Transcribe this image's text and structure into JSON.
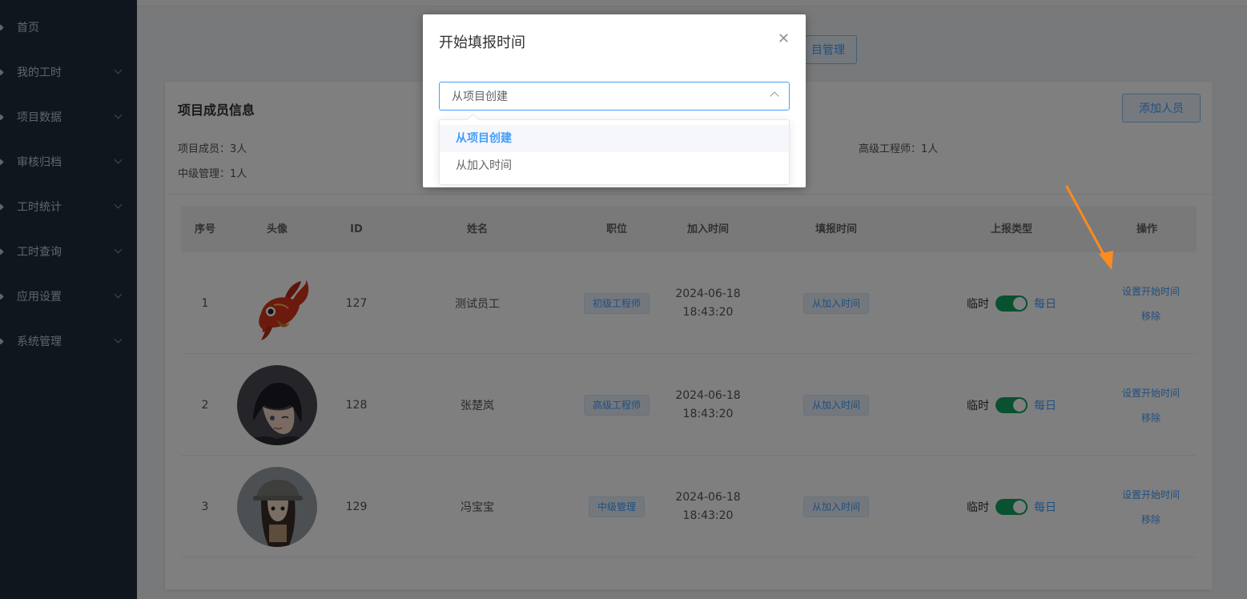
{
  "sidebar": {
    "items": [
      {
        "label": "首页",
        "icon": "home-icon",
        "has_arrow": false
      },
      {
        "label": "我的工时",
        "icon": "clock-icon",
        "has_arrow": true
      },
      {
        "label": "项目数据",
        "icon": "grid-icon",
        "has_arrow": true
      },
      {
        "label": "审核归档",
        "icon": "check-icon",
        "has_arrow": true
      },
      {
        "label": "工时统计",
        "icon": "chart-icon",
        "has_arrow": true
      },
      {
        "label": "工时查询",
        "icon": "search-icon",
        "has_arrow": true
      },
      {
        "label": "应用设置",
        "icon": "app-icon",
        "has_arrow": true
      },
      {
        "label": "系统管理",
        "icon": "gear-icon",
        "has_arrow": true
      }
    ]
  },
  "header": {
    "project_mgmt_label": "目管理"
  },
  "card": {
    "title": "项目成员信息",
    "add_button": "添加人员",
    "stats": {
      "members": "项目成员：3人",
      "senior_engineer": "高级工程师：1人",
      "mid_management": "中级管理：1人"
    }
  },
  "table": {
    "columns": [
      "序号",
      "头像",
      "ID",
      "姓名",
      "职位",
      "加入时间",
      "填报时间",
      "上报类型",
      "操作"
    ],
    "rows": [
      {
        "index": "1",
        "avatar": "fish-avatar",
        "id": "127",
        "name": "测试员工",
        "position": "初级工程师",
        "join_date": "2024-06-18",
        "join_time": "18:43:20",
        "report_time": "从加入时间",
        "type_off": "临时",
        "type_on": "每日",
        "op_set": "设置开始时间",
        "op_remove": "移除"
      },
      {
        "index": "2",
        "avatar": "boy-avatar",
        "id": "128",
        "name": "张楚岚",
        "position": "高级工程师",
        "join_date": "2024-06-18",
        "join_time": "18:43:20",
        "report_time": "从加入时间",
        "type_off": "临时",
        "type_on": "每日",
        "op_set": "设置开始时间",
        "op_remove": "移除"
      },
      {
        "index": "3",
        "avatar": "girl-avatar",
        "id": "129",
        "name": "冯宝宝",
        "position": "中级管理",
        "join_date": "2024-06-18",
        "join_time": "18:43:20",
        "report_time": "从加入时间",
        "type_off": "临时",
        "type_on": "每日",
        "op_set": "设置开始时间",
        "op_remove": "移除"
      }
    ]
  },
  "dialog": {
    "title": "开始填报时间",
    "close_icon": "close-icon",
    "select_value": "从项目创建",
    "options": [
      "从项目创建",
      "从加入时间"
    ],
    "selected_index": 0
  },
  "colors": {
    "sidebar_bg": "#1f2d3d",
    "primary": "#409eff",
    "switch_on": "#13a360",
    "annotation_arrow": "#ff8a1f"
  }
}
